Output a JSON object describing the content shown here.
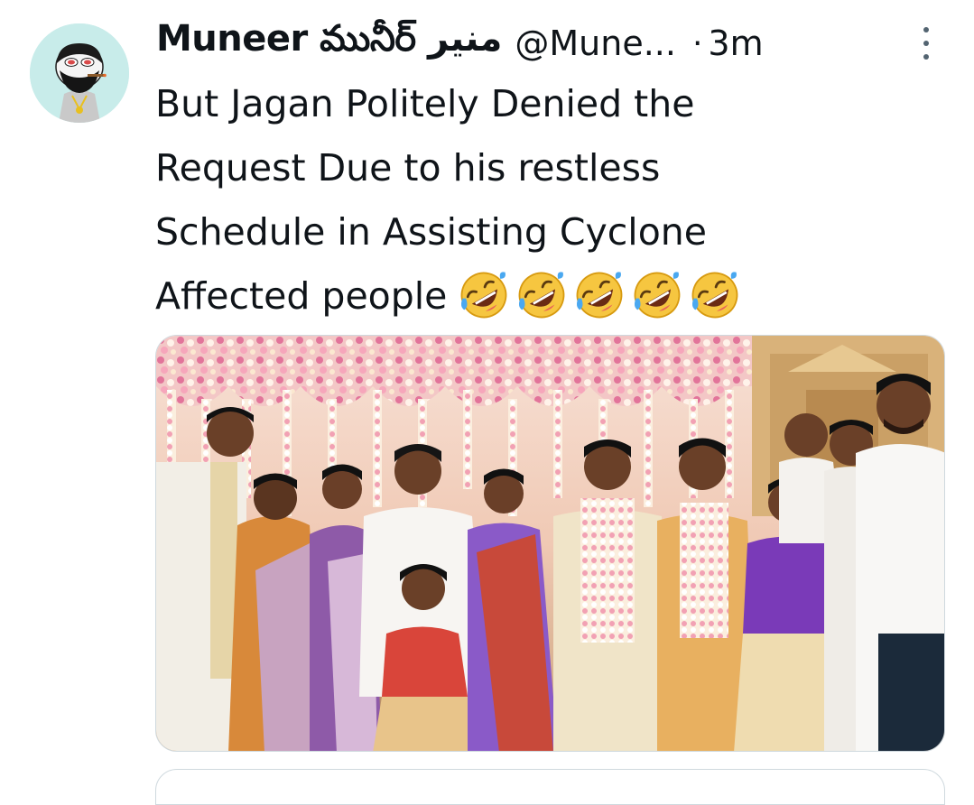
{
  "tweet": {
    "display_name": "Muneer మునీర్ منير",
    "handle": "@Mune...",
    "separator": "·",
    "time": "3m",
    "text_lines": [
      "But Jagan Politely Denied the",
      "Request Due to his restless",
      "Schedule in Assisting Cyclone",
      "Affected people"
    ],
    "emojis": [
      "rolling-on-floor-laughing",
      "rolling-on-floor-laughing",
      "rolling-on-floor-laughing",
      "rolling-on-floor-laughing",
      "rolling-on-floor-laughing"
    ],
    "more_icon": "more-vertical-icon"
  },
  "avatar": {
    "icon": "cartoon-avatar",
    "background": "#c8ecea"
  },
  "media": {
    "type": "photo",
    "palette": {
      "backdrop": "#f2d2c8",
      "flowers_pink": "#e88aa8",
      "flowers_white": "#fff4ea",
      "gold": "#d8a850",
      "white_shirt": "#f5f3f0",
      "purple": "#7a4aa8",
      "red": "#c8383a"
    }
  },
  "colors": {
    "text": "#0f1419",
    "muted": "#536471",
    "border": "#cfd9de"
  }
}
